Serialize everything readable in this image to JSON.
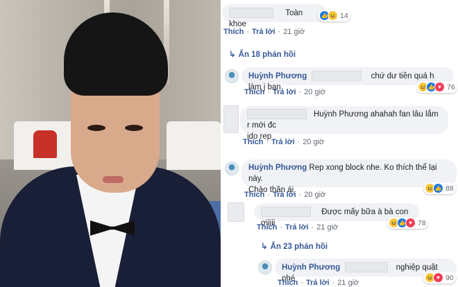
{
  "comments": [
    {
      "name": "",
      "text": "Toàn khoe",
      "reactions": [
        "like",
        "haha"
      ],
      "count": "14",
      "action_like": "Thích",
      "action_reply": "Trả lời",
      "time": "21 giờ"
    },
    {
      "name": "Huỳnh Phương",
      "text": "chứ dư tiền quá h làm j bạn",
      "reactions": [
        "haha",
        "like",
        "love"
      ],
      "count": "76",
      "action_like": "Thích",
      "action_reply": "Trả lời",
      "time": "20 giờ"
    },
    {
      "name": "",
      "text_line1": "Huỳnh Phương ahahah fan lâu lắm r mới đc",
      "text_line2": "ido rep",
      "action_like": "Thích",
      "action_reply": "Trả lời",
      "time": "20 giờ"
    },
    {
      "name": "Huỳnh Phương",
      "text_line1": "Rep xong block nhe. Ko thích thể lại này.",
      "text_line2": "Chào thân ái",
      "reactions": [
        "haha",
        "like",
        "love"
      ],
      "count": "88",
      "action_like": "Thích",
      "action_reply": "Trả lời",
      "time": "20 giờ"
    },
    {
      "name": "",
      "text": "Được mấy bữa à bà con ơiiiii",
      "reactions": [
        "haha",
        "like",
        "love"
      ],
      "count": "78",
      "action_like": "Thích",
      "action_reply": "Trả lời",
      "time": "21 giờ"
    },
    {
      "name": "Huỳnh Phương",
      "text": "nghiệp quật nhé",
      "reactions": [
        "haha",
        "like",
        "love"
      ],
      "count": "90",
      "action_like": "Thích",
      "action_reply": "Trả lời",
      "time": "21 giờ"
    }
  ],
  "toggles": {
    "hidden_18": "Ẩn 18 phản hồi",
    "hidden_23": "Ẩn 23 phản hồi"
  },
  "icons": {
    "reply_arrow": "reply-arrow-icon",
    "haha": "haha-reaction-icon",
    "like": "like-reaction-icon",
    "love": "love-reaction-icon"
  },
  "colors": {
    "link": "#385898",
    "bubble": "#f0f2f5",
    "meta": "#606770"
  }
}
